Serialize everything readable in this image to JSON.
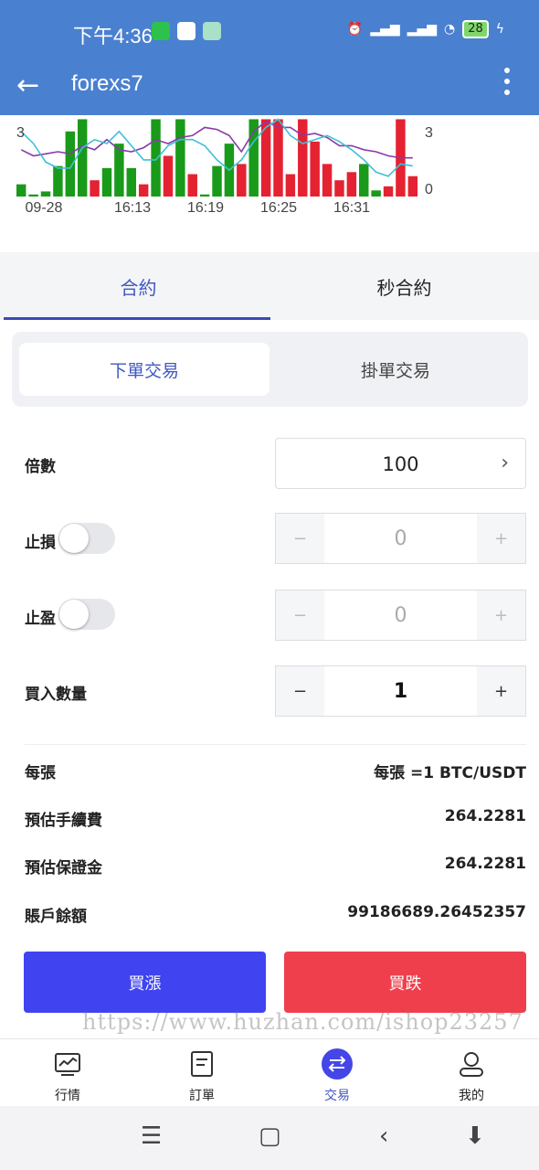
{
  "status_bar": {
    "time": "下午4:36",
    "battery": "28"
  },
  "header": {
    "back_icon": "arrow-left-icon",
    "title": "forexs7",
    "more_icon": "more-vertical-icon",
    "color": "#4a80d0"
  },
  "chart_data": {
    "type": "bar",
    "x_tick_labels": [
      "09-28",
      "16:13",
      "16:19",
      "16:25",
      "16:31"
    ],
    "y_left_ticks": [
      "3"
    ],
    "y_right_ticks": [
      "3",
      "0"
    ],
    "bars": [
      {
        "color": "green",
        "value": 0.6
      },
      {
        "color": "green",
        "value": 0.1
      },
      {
        "color": "green",
        "value": 0.25
      },
      {
        "color": "green",
        "value": 1.5
      },
      {
        "color": "green",
        "value": 3.2
      },
      {
        "color": "green",
        "value": 3.8
      },
      {
        "color": "red",
        "value": 0.8
      },
      {
        "color": "green",
        "value": 1.4
      },
      {
        "color": "green",
        "value": 2.6
      },
      {
        "color": "green",
        "value": 1.4
      },
      {
        "color": "red",
        "value": 0.6
      },
      {
        "color": "green",
        "value": 3.8
      },
      {
        "color": "red",
        "value": 2.0
      },
      {
        "color": "green",
        "value": 3.8
      },
      {
        "color": "red",
        "value": 1.1
      },
      {
        "color": "green",
        "value": 0.1
      },
      {
        "color": "green",
        "value": 1.5
      },
      {
        "color": "green",
        "value": 2.6
      },
      {
        "color": "red",
        "value": 1.6
      },
      {
        "color": "green",
        "value": 3.8
      },
      {
        "color": "red",
        "value": 3.8
      },
      {
        "color": "red",
        "value": 3.8
      },
      {
        "color": "red",
        "value": 1.1
      },
      {
        "color": "red",
        "value": 3.8
      },
      {
        "color": "red",
        "value": 2.7
      },
      {
        "color": "red",
        "value": 1.6
      },
      {
        "color": "red",
        "value": 0.8
      },
      {
        "color": "red",
        "value": 1.2
      },
      {
        "color": "green",
        "value": 1.6
      },
      {
        "color": "green",
        "value": 0.3
      },
      {
        "color": "red",
        "value": 0.5
      },
      {
        "color": "red",
        "value": 3.8
      },
      {
        "color": "red",
        "value": 1.0
      }
    ],
    "ma_purple": [
      2.3,
      2.0,
      2.1,
      2.2,
      2.1,
      2.5,
      2.3,
      2.8,
      2.3,
      2.2,
      2.4,
      2.8,
      2.6,
      2.9,
      3.0,
      3.4,
      3.3,
      3.0,
      2.2,
      3.2,
      3.7,
      3.4,
      3.4,
      3.0,
      3.1,
      2.9,
      2.5,
      2.5,
      2.3,
      2.2,
      2.0,
      1.9,
      1.9
    ],
    "ma_cyan": [
      3.2,
      2.6,
      1.7,
      1.4,
      1.4,
      2.4,
      2.8,
      2.6,
      3.2,
      2.5,
      1.8,
      1.8,
      2.5,
      2.8,
      2.8,
      2.5,
      1.8,
      1.3,
      1.8,
      2.7,
      3.4,
      3.8,
      3.0,
      2.6,
      2.8,
      3.0,
      2.7,
      2.3,
      1.8,
      1.2,
      1.0,
      1.6,
      1.5
    ],
    "ylim": [
      0,
      4
    ],
    "colors": {
      "green": "#1a9a1a",
      "red": "#e42231",
      "ma_purple": "#8a3aa8",
      "ma_cyan": "#3fc0d6"
    }
  },
  "tabs": [
    {
      "label": "合約",
      "active": true
    },
    {
      "label": "秒合約",
      "active": false
    }
  ],
  "order_type": {
    "options": [
      "下單交易",
      "掛單交易"
    ],
    "selected": "下單交易"
  },
  "form": {
    "multiplier_label": "倍數",
    "multiplier_value": "100",
    "stop_loss_label": "止損",
    "stop_loss_value": "0",
    "take_profit_label": "止盈",
    "take_profit_value": "0",
    "quantity_label": "買入數量",
    "quantity_value": "1",
    "minus": "−",
    "plus": "+"
  },
  "info": [
    {
      "label": "每張",
      "value": "每張 =1 BTC/USDT"
    },
    {
      "label": "預估手續費",
      "value": "264.2281"
    },
    {
      "label": "預估保證金",
      "value": "264.2281"
    },
    {
      "label": "賬戶餘額",
      "value": "99186689.26452357"
    }
  ],
  "actions": {
    "buy_label": "買漲",
    "sell_label": "買跌",
    "buy_color": "#3f43f0",
    "sell_color": "#ef3f4d"
  },
  "watermark": "https://www.huzhan.com/ishop23257",
  "bottom_nav": [
    {
      "label": "行情",
      "icon": "chart-icon"
    },
    {
      "label": "訂單",
      "icon": "document-icon"
    },
    {
      "label": "交易",
      "icon": "exchange-icon",
      "active": true
    },
    {
      "label": "我的",
      "icon": "user-icon"
    }
  ]
}
